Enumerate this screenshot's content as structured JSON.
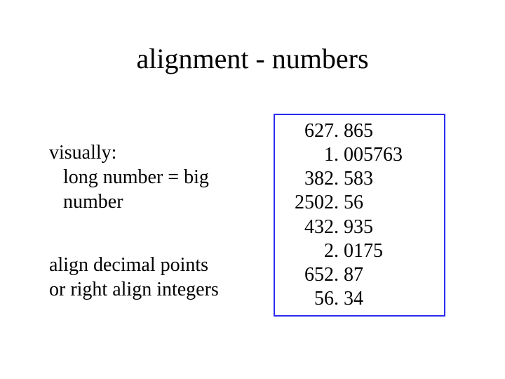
{
  "title": "alignment - numbers",
  "left": {
    "visually": "visually:",
    "long_eq_big": "long number = big number",
    "align_decimal": "align decimal points",
    "right_align": "or right align integers"
  },
  "numbers": [
    {
      "int": "627",
      "frac": ". 865"
    },
    {
      "int": "1",
      "frac": ". 005763"
    },
    {
      "int": "382",
      "frac": ". 583"
    },
    {
      "int": "2502",
      "frac": ". 56"
    },
    {
      "int": "432",
      "frac": ". 935"
    },
    {
      "int": "2",
      "frac": ". 0175"
    },
    {
      "int": "652",
      "frac": ". 87"
    },
    {
      "int": "56",
      "frac": ". 34"
    }
  ]
}
